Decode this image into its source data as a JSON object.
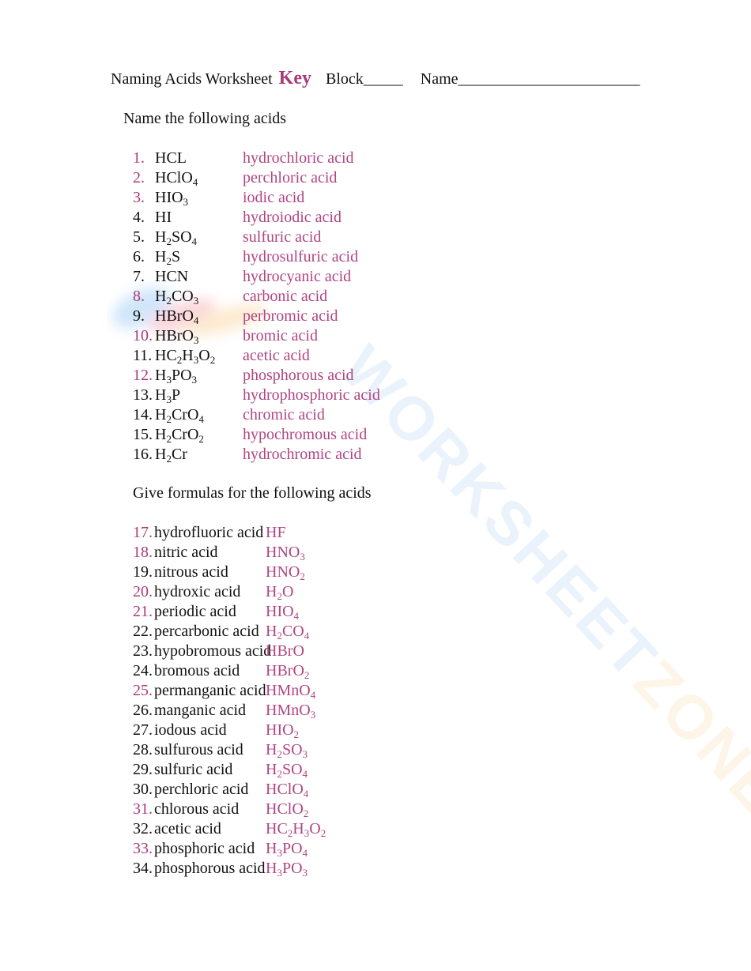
{
  "header": {
    "title": "Naming Acids Worksheet",
    "key_label": "Key",
    "block_label": "Block_____",
    "name_label": "Name_______________________"
  },
  "watermark": {
    "part1": "WORKSHEET",
    "part2": "ZONE"
  },
  "colors": {
    "answer_pink": "#a93a7a",
    "text": "#111111"
  },
  "section1": {
    "title": "Name the following acids",
    "items": [
      {
        "num": "1.",
        "q": "HCL",
        "a": "hydrochloric acid",
        "num_pink": true
      },
      {
        "num": "2.",
        "q": "HClO<sub>4</sub>",
        "a": "perchloric acid",
        "num_pink": true
      },
      {
        "num": "3.",
        "q": "HIO<sub>3</sub>",
        "a": "iodic acid",
        "num_pink": true
      },
      {
        "num": "4.",
        "q": "HI",
        "a": "hydroiodic acid",
        "num_pink": false
      },
      {
        "num": "5.",
        "q": "H<sub>2</sub>SO<sub>4</sub>",
        "a": "sulfuric acid",
        "num_pink": false
      },
      {
        "num": "6.",
        "q": "H<sub>2</sub>S",
        "a": "hydrosulfuric acid",
        "num_pink": false
      },
      {
        "num": "7.",
        "q": "HCN",
        "a": "hydrocyanic acid",
        "num_pink": false
      },
      {
        "num": "8.",
        "q": "H<sub>2</sub>CO<sub>3</sub>",
        "a": "carbonic acid",
        "num_pink": true
      },
      {
        "num": "9.",
        "q": "HBrO<sub>4</sub>",
        "a": "perbromic acid",
        "num_pink": false
      },
      {
        "num": "10.",
        "q": "HBrO<sub>3</sub>",
        "a": "bromic acid",
        "num_pink": true
      },
      {
        "num": "11.",
        "q": "HC<sub>2</sub>H<sub>3</sub>O<sub>2</sub>",
        "a": "acetic acid",
        "num_pink": false
      },
      {
        "num": "12.",
        "q": "H<sub>3</sub>PO<sub>3</sub>",
        "a": "phosphorous acid",
        "num_pink": true
      },
      {
        "num": "13.",
        "q": "H<sub>3</sub>P",
        "a": "hydrophosphoric acid",
        "num_pink": false
      },
      {
        "num": "14.",
        "q": "H<sub>2</sub>CrO<sub>4</sub>",
        "a": "chromic acid",
        "num_pink": false
      },
      {
        "num": "15.",
        "q": "H<sub>2</sub>CrO<sub>2</sub>",
        "a": "hypochromous acid",
        "num_pink": false
      },
      {
        "num": "16.",
        "q": "H<sub>2</sub>Cr",
        "a": "hydrochromic acid",
        "num_pink": false
      }
    ]
  },
  "section2": {
    "title": "Give formulas for the following acids",
    "items": [
      {
        "num": "17.",
        "q": "hydrofluoric acid",
        "a": "HF",
        "num_pink": true
      },
      {
        "num": "18.",
        "q": "nitric acid",
        "a": "HNO<sub>3</sub>",
        "num_pink": true
      },
      {
        "num": "19.",
        "q": "nitrous acid",
        "a": "HNO<sub>2</sub>",
        "num_pink": false
      },
      {
        "num": "20.",
        "q": "hydroxic acid",
        "a": "H<sub>2</sub>O",
        "num_pink": true
      },
      {
        "num": "21.",
        "q": "periodic acid",
        "a": "HIO<sub>4</sub>",
        "num_pink": true
      },
      {
        "num": "22.",
        "q": "percarbonic acid",
        "a": "H<sub>2</sub>CO<sub>4</sub>",
        "num_pink": false
      },
      {
        "num": "23.",
        "q": "hypobromous acid",
        "a": "HBrO",
        "num_pink": false
      },
      {
        "num": "24.",
        "q": "bromous acid",
        "a": "HBrO<sub>2</sub>",
        "num_pink": false
      },
      {
        "num": "25.",
        "q": "permanganic acid",
        "a": "HMnO<sub>4</sub>",
        "num_pink": true
      },
      {
        "num": "26.",
        "q": "manganic acid",
        "a": "HMnO<sub>3</sub>",
        "num_pink": false
      },
      {
        "num": "27.",
        "q": "iodous acid",
        "a": "HIO<sub>2</sub>",
        "num_pink": false
      },
      {
        "num": "28.",
        "q": "sulfurous acid",
        "a": "H<sub>2</sub>SO<sub>3</sub>",
        "num_pink": false
      },
      {
        "num": "29.",
        "q": "sulfuric acid",
        "a": "H<sub>2</sub>SO<sub>4</sub>",
        "num_pink": false
      },
      {
        "num": "30.",
        "q": "perchloric acid",
        "a": "HClO<sub>4</sub>",
        "num_pink": false
      },
      {
        "num": "31.",
        "q": "chlorous acid",
        "a": "HClO<sub>2</sub>",
        "num_pink": true
      },
      {
        "num": "32.",
        "q": "acetic acid",
        "a": "HC<sub>2</sub>H<sub>3</sub>O<sub>2</sub>",
        "num_pink": false
      },
      {
        "num": "33.",
        "q": "phosphoric acid",
        "a": "H<sub>3</sub>PO<sub>4</sub>",
        "num_pink": true
      },
      {
        "num": "34.",
        "q": "phosphorous acid",
        "a": "H<sub>3</sub>PO<sub>3</sub>",
        "num_pink": false
      }
    ]
  }
}
